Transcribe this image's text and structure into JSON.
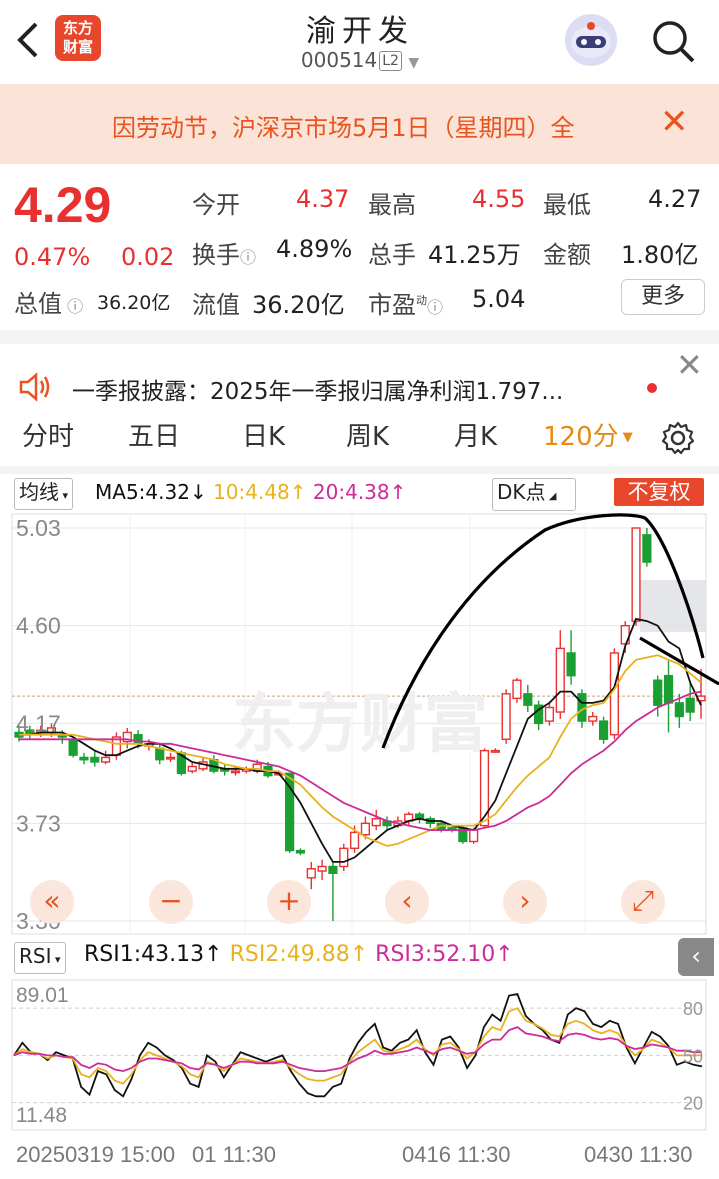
{
  "header": {
    "back_icon": "back-arrow-icon",
    "logo_line1": "东方",
    "logo_line2": "财富",
    "title": "渝开发",
    "code": "000514",
    "level": "L2"
  },
  "notice": {
    "text": "因劳动节，沪深京市场5月1日（星期四）全",
    "close": "✕"
  },
  "quote": {
    "price": "4.29",
    "change_pct": "0.47%",
    "change": "0.02",
    "open_label": "今开",
    "open": "4.37",
    "high_label": "最高",
    "high": "4.55",
    "low_label": "最低",
    "low": "4.27",
    "turnover_label": "换手",
    "turnover": "4.89%",
    "volume_label": "总手",
    "volume": "41.25万",
    "amount_label": "金额",
    "amount": "1.80亿",
    "mktcap_label": "总值",
    "mktcap": "36.20亿",
    "float_label": "流值",
    "float": "36.20亿",
    "pe_label": "市盈",
    "pe_sup": "动",
    "pe": "5.04",
    "more": "更多"
  },
  "announcement": {
    "text": "一季报披露：2025年一季报归属净利润1.797...",
    "close": "✕"
  },
  "tabs": [
    "分时",
    "五日",
    "日K",
    "周K",
    "月K",
    "120分"
  ],
  "chart_header": {
    "ma_selector": "均线",
    "ma5": "MA5:4.32",
    "ma5_arrow": "↓",
    "ma10": "10:4.48",
    "ma10_arrow": "↑",
    "ma20": "20:4.38",
    "ma20_arrow": "↑",
    "dk": "DK点",
    "fuquan": "不复权"
  },
  "watermark": "东方财富",
  "colors": {
    "up": "#e93030",
    "down": "#1aa032",
    "ma5": "#111111",
    "ma10": "#e8b21e",
    "ma20": "#cc2b9a",
    "accent": "#e8541f"
  },
  "controls": [
    "«",
    "−",
    "+",
    "‹",
    "›",
    "⤢"
  ],
  "rsi_header": {
    "selector": "RSI",
    "rsi1": "RSI1:43.13",
    "rsi1_arrow": "↑",
    "rsi2": "RSI2:49.88",
    "rsi2_arrow": "↑",
    "rsi3": "RSI3:52.10",
    "rsi3_arrow": "↑"
  },
  "x_labels": [
    "20250319 15:00",
    "01 11:30",
    "0416 11:30",
    "0430 11:30"
  ],
  "chart_data": [
    {
      "type": "candlestick",
      "price_axis": [
        "5.03",
        "4.60",
        "4.17",
        "3.73",
        "3.30"
      ],
      "ylim": [
        3.3,
        5.03
      ],
      "candles": [
        {
          "o": 4.13,
          "c": 4.11,
          "h": 4.16,
          "l": 4.09
        },
        {
          "o": 4.14,
          "c": 4.12,
          "h": 4.16,
          "l": 4.1
        },
        {
          "o": 4.13,
          "c": 4.14,
          "h": 4.16,
          "l": 4.11
        },
        {
          "o": 4.13,
          "c": 4.15,
          "h": 4.17,
          "l": 4.11
        },
        {
          "o": 4.12,
          "c": 4.11,
          "h": 4.14,
          "l": 4.08
        },
        {
          "o": 4.1,
          "c": 4.03,
          "h": 4.11,
          "l": 4.02
        },
        {
          "o": 4.02,
          "c": 4.01,
          "h": 4.04,
          "l": 3.99
        },
        {
          "o": 4.02,
          "c": 4.0,
          "h": 4.05,
          "l": 3.98
        },
        {
          "o": 4.0,
          "c": 4.02,
          "h": 4.05,
          "l": 3.99
        },
        {
          "o": 4.03,
          "c": 4.11,
          "h": 4.13,
          "l": 4.01
        },
        {
          "o": 4.09,
          "c": 4.13,
          "h": 4.15,
          "l": 4.06
        },
        {
          "o": 4.12,
          "c": 4.08,
          "h": 4.14,
          "l": 4.06
        },
        {
          "o": 4.07,
          "c": 4.08,
          "h": 4.1,
          "l": 4.05
        },
        {
          "o": 4.06,
          "c": 4.01,
          "h": 4.08,
          "l": 3.99
        },
        {
          "o": 4.02,
          "c": 4.02,
          "h": 4.04,
          "l": 4.0
        },
        {
          "o": 4.04,
          "c": 3.95,
          "h": 4.05,
          "l": 3.94
        },
        {
          "o": 3.96,
          "c": 3.98,
          "h": 4.0,
          "l": 3.95
        },
        {
          "o": 3.97,
          "c": 4.0,
          "h": 4.02,
          "l": 3.96
        },
        {
          "o": 4.01,
          "c": 3.96,
          "h": 4.03,
          "l": 3.95
        },
        {
          "o": 3.97,
          "c": 3.96,
          "h": 3.99,
          "l": 3.94
        },
        {
          "o": 3.96,
          "c": 3.96,
          "h": 3.98,
          "l": 3.94
        },
        {
          "o": 3.96,
          "c": 3.97,
          "h": 3.98,
          "l": 3.95
        },
        {
          "o": 3.96,
          "c": 3.99,
          "h": 4.01,
          "l": 3.95
        },
        {
          "o": 3.98,
          "c": 3.94,
          "h": 4.0,
          "l": 3.93
        },
        {
          "o": 3.95,
          "c": 3.95,
          "h": 3.96,
          "l": 3.94
        },
        {
          "o": 3.95,
          "c": 3.61,
          "h": 3.95,
          "l": 3.6
        },
        {
          "o": 3.61,
          "c": 3.6,
          "h": 3.62,
          "l": 3.59
        },
        {
          "o": 3.49,
          "c": 3.53,
          "h": 3.56,
          "l": 3.44
        },
        {
          "o": 3.52,
          "c": 3.54,
          "h": 3.57,
          "l": 3.48
        },
        {
          "o": 3.54,
          "c": 3.51,
          "h": 3.56,
          "l": 3.3
        },
        {
          "o": 3.54,
          "c": 3.62,
          "h": 3.64,
          "l": 3.52
        },
        {
          "o": 3.62,
          "c": 3.69,
          "h": 3.72,
          "l": 3.6
        },
        {
          "o": 3.68,
          "c": 3.73,
          "h": 3.76,
          "l": 3.66
        },
        {
          "o": 3.72,
          "c": 3.75,
          "h": 3.79,
          "l": 3.7
        },
        {
          "o": 3.74,
          "c": 3.72,
          "h": 3.76,
          "l": 3.7
        },
        {
          "o": 3.72,
          "c": 3.74,
          "h": 3.76,
          "l": 3.71
        },
        {
          "o": 3.74,
          "c": 3.77,
          "h": 3.78,
          "l": 3.72
        },
        {
          "o": 3.77,
          "c": 3.75,
          "h": 3.78,
          "l": 3.73
        },
        {
          "o": 3.75,
          "c": 3.73,
          "h": 3.76,
          "l": 3.71
        },
        {
          "o": 3.73,
          "c": 3.7,
          "h": 3.74,
          "l": 3.69
        },
        {
          "o": 3.71,
          "c": 3.7,
          "h": 3.72,
          "l": 3.69
        },
        {
          "o": 3.71,
          "c": 3.65,
          "h": 3.72,
          "l": 3.64
        },
        {
          "o": 3.65,
          "c": 3.7,
          "h": 3.71,
          "l": 3.64
        },
        {
          "o": 3.72,
          "c": 4.05,
          "h": 4.06,
          "l": 3.71
        },
        {
          "o": 4.05,
          "c": 4.05,
          "h": 4.06,
          "l": 4.04
        },
        {
          "o": 4.1,
          "c": 4.3,
          "h": 4.32,
          "l": 4.08
        },
        {
          "o": 4.28,
          "c": 4.36,
          "h": 4.37,
          "l": 4.26
        },
        {
          "o": 4.3,
          "c": 4.25,
          "h": 4.34,
          "l": 4.22
        },
        {
          "o": 4.25,
          "c": 4.17,
          "h": 4.27,
          "l": 4.14
        },
        {
          "o": 4.18,
          "c": 4.24,
          "h": 4.26,
          "l": 4.16
        },
        {
          "o": 4.22,
          "c": 4.5,
          "h": 4.58,
          "l": 4.19
        },
        {
          "o": 4.48,
          "c": 4.38,
          "h": 4.58,
          "l": 4.34
        },
        {
          "o": 4.3,
          "c": 4.18,
          "h": 4.32,
          "l": 4.15
        },
        {
          "o": 4.18,
          "c": 4.2,
          "h": 4.22,
          "l": 4.16
        },
        {
          "o": 4.18,
          "c": 4.1,
          "h": 4.2,
          "l": 4.08
        },
        {
          "o": 4.12,
          "c": 4.48,
          "h": 4.5,
          "l": 4.1
        },
        {
          "o": 4.52,
          "c": 4.6,
          "h": 4.62,
          "l": 4.48
        },
        {
          "o": 4.62,
          "c": 5.03,
          "h": 5.03,
          "l": 4.6
        },
        {
          "o": 5.0,
          "c": 4.88,
          "h": 5.03,
          "l": 4.86
        },
        {
          "o": 4.36,
          "c": 4.25,
          "h": 4.38,
          "l": 4.2
        },
        {
          "o": 4.38,
          "c": 4.26,
          "h": 4.45,
          "l": 4.13
        },
        {
          "o": 4.26,
          "c": 4.2,
          "h": 4.3,
          "l": 4.15
        },
        {
          "o": 4.28,
          "c": 4.22,
          "h": 4.35,
          "l": 4.18
        },
        {
          "o": 4.27,
          "c": 4.29,
          "h": 4.41,
          "l": 4.19
        }
      ],
      "ma5": [
        4.12,
        4.12,
        4.13,
        4.13,
        4.13,
        4.11,
        4.08,
        4.05,
        4.03,
        4.03,
        4.05,
        4.07,
        4.08,
        4.08,
        4.06,
        4.03,
        4.0,
        3.99,
        3.98,
        3.97,
        3.97,
        3.97,
        3.96,
        3.96,
        3.95,
        3.89,
        3.82,
        3.73,
        3.64,
        3.56,
        3.56,
        3.58,
        3.62,
        3.66,
        3.7,
        3.72,
        3.74,
        3.75,
        3.74,
        3.74,
        3.72,
        3.71,
        3.7,
        3.76,
        3.83,
        3.95,
        4.07,
        4.19,
        4.23,
        4.26,
        4.31,
        4.31,
        4.26,
        4.26,
        4.27,
        4.33,
        4.51,
        4.63,
        4.62,
        4.6,
        4.53,
        4.5,
        4.35,
        4.25
      ],
      "ma10": [
        4.12,
        4.12,
        4.12,
        4.12,
        4.12,
        4.12,
        4.11,
        4.1,
        4.09,
        4.08,
        4.08,
        4.08,
        4.07,
        4.06,
        4.05,
        4.04,
        4.03,
        4.02,
        4.01,
        3.99,
        3.98,
        3.97,
        3.97,
        3.96,
        3.96,
        3.93,
        3.9,
        3.85,
        3.8,
        3.76,
        3.73,
        3.7,
        3.67,
        3.65,
        3.63,
        3.64,
        3.66,
        3.68,
        3.7,
        3.72,
        3.72,
        3.72,
        3.72,
        3.74,
        3.77,
        3.83,
        3.89,
        3.94,
        3.98,
        4.02,
        4.11,
        4.19,
        4.23,
        4.25,
        4.26,
        4.32,
        4.4,
        4.45,
        4.46,
        4.47,
        4.45,
        4.43,
        4.39,
        4.35
      ],
      "ma20": [
        4.1,
        4.1,
        4.1,
        4.1,
        4.1,
        4.1,
        4.1,
        4.1,
        4.1,
        4.1,
        4.1,
        4.09,
        4.09,
        4.08,
        4.08,
        4.07,
        4.06,
        4.05,
        4.04,
        4.03,
        4.02,
        4.01,
        4.0,
        3.99,
        3.98,
        3.96,
        3.94,
        3.91,
        3.88,
        3.85,
        3.82,
        3.8,
        3.78,
        3.76,
        3.74,
        3.73,
        3.72,
        3.71,
        3.7,
        3.7,
        3.7,
        3.7,
        3.7,
        3.71,
        3.72,
        3.74,
        3.77,
        3.8,
        3.82,
        3.85,
        3.9,
        3.95,
        3.99,
        4.02,
        4.05,
        4.09,
        4.14,
        4.18,
        4.21,
        4.24,
        4.26,
        4.28,
        4.3,
        4.31
      ]
    },
    {
      "type": "line",
      "title": "RSI",
      "y_axis_left": [
        "89.01",
        "11.48"
      ],
      "y_axis_right": [
        "80",
        "50",
        "20"
      ],
      "ylim": [
        11.48,
        89.01
      ],
      "series": [
        {
          "name": "RSI1",
          "values": [
            50,
            58,
            52,
            51,
            47,
            52,
            50,
            48,
            30,
            25,
            40,
            38,
            28,
            24,
            35,
            50,
            58,
            55,
            50,
            47,
            42,
            32,
            30,
            50,
            46,
            36,
            44,
            52,
            50,
            48,
            46,
            48,
            50,
            40,
            32,
            26,
            24,
            24,
            30,
            32,
            48,
            58,
            65,
            70,
            55,
            53,
            58,
            60,
            66,
            52,
            44,
            60,
            62,
            55,
            42,
            50,
            68,
            76,
            72,
            88,
            89,
            75,
            70,
            66,
            60,
            58,
            76,
            80,
            78,
            70,
            68,
            72,
            70,
            55,
            45,
            55,
            65,
            62,
            56,
            44,
            46,
            44,
            43
          ]
        },
        {
          "name": "RSI2",
          "values": [
            50,
            54,
            52,
            51,
            48,
            50,
            49,
            48,
            38,
            36,
            42,
            40,
            34,
            32,
            38,
            47,
            52,
            50,
            48,
            46,
            43,
            38,
            36,
            46,
            44,
            40,
            44,
            48,
            47,
            46,
            45,
            46,
            47,
            42,
            38,
            35,
            34,
            34,
            36,
            38,
            46,
            52,
            56,
            60,
            53,
            52,
            54,
            56,
            60,
            54,
            50,
            57,
            58,
            54,
            48,
            52,
            62,
            68,
            66,
            78,
            80,
            72,
            70,
            67,
            63,
            62,
            70,
            72,
            70,
            66,
            64,
            66,
            64,
            56,
            50,
            54,
            60,
            58,
            55,
            50,
            50,
            50,
            50
          ]
        },
        {
          "name": "RSI3",
          "values": [
            50,
            52,
            51,
            51,
            50,
            50,
            49,
            49,
            44,
            42,
            45,
            44,
            41,
            40,
            42,
            46,
            48,
            48,
            47,
            46,
            45,
            42,
            41,
            45,
            44,
            42,
            44,
            46,
            46,
            45,
            45,
            45,
            46,
            44,
            42,
            41,
            40,
            40,
            41,
            42,
            45,
            48,
            50,
            53,
            51,
            51,
            52,
            53,
            55,
            53,
            51,
            54,
            55,
            53,
            51,
            52,
            57,
            60,
            60,
            66,
            68,
            64,
            63,
            62,
            60,
            59,
            63,
            64,
            63,
            61,
            60,
            61,
            60,
            56,
            54,
            55,
            57,
            56,
            55,
            53,
            53,
            52,
            52
          ]
        }
      ]
    }
  ]
}
